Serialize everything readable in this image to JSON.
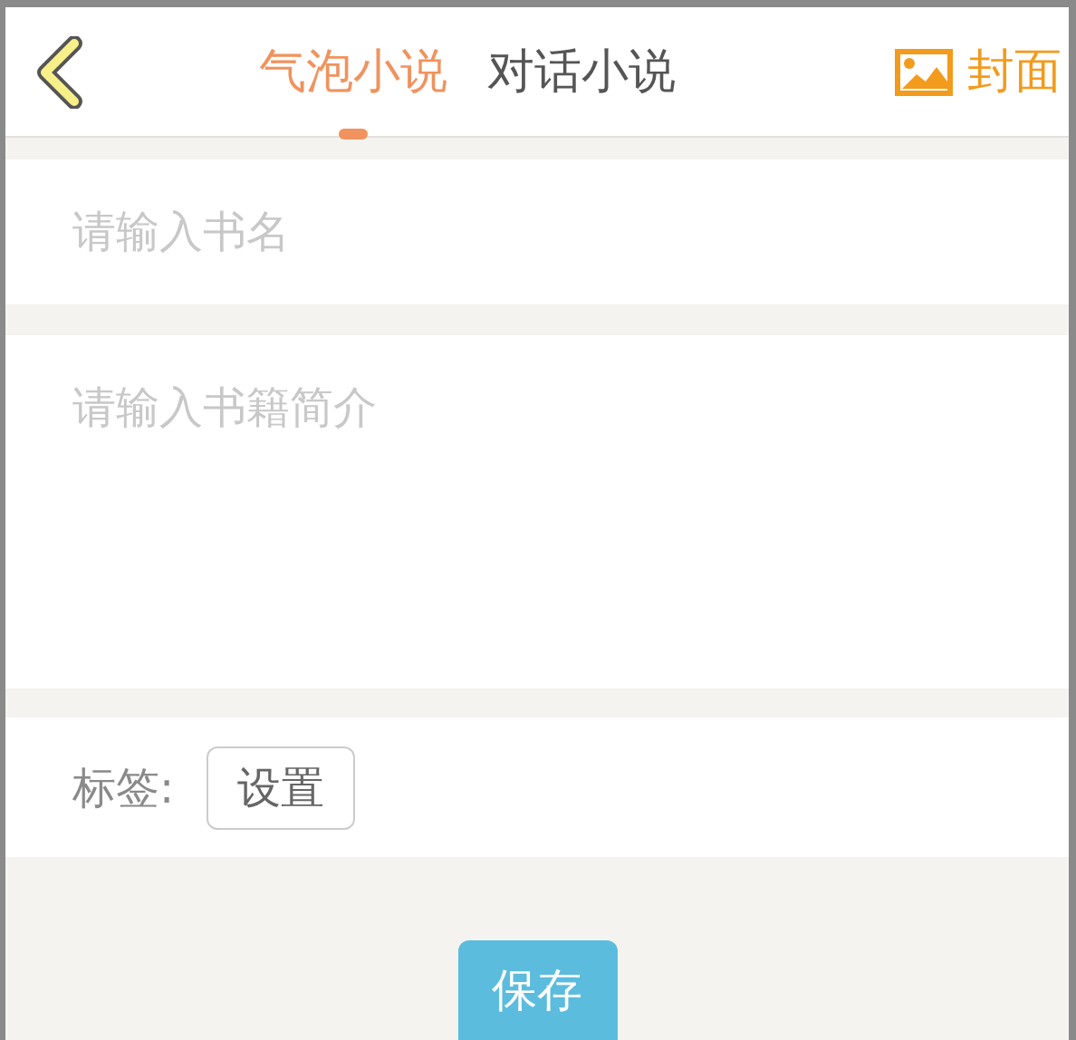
{
  "header": {
    "tabs": [
      {
        "label": "气泡小说",
        "selected": true
      },
      {
        "label": "对话小说",
        "selected": false
      }
    ],
    "cover_button": "封面"
  },
  "form": {
    "title_placeholder": "请输入书名",
    "intro_placeholder": "请输入书籍简介",
    "tag_label": "标签:",
    "tag_button": "设置"
  },
  "save_button": "保存"
}
